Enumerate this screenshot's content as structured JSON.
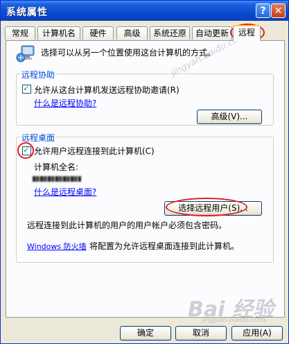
{
  "window": {
    "title": "系统属性"
  },
  "title_buttons": {
    "help": "?",
    "close": "✕"
  },
  "tabs": [
    {
      "label": "常规"
    },
    {
      "label": "计算机名"
    },
    {
      "label": "硬件"
    },
    {
      "label": "高级"
    },
    {
      "label": "系统还原"
    },
    {
      "label": "自动更新"
    },
    {
      "label": "远程",
      "active": true
    }
  ],
  "intro": {
    "text": "选择可以从另一个位置使用这台计算机的方式。"
  },
  "remote_assistance": {
    "group_title": "远程协助",
    "checkbox_label": "允许从这台计算机发送远程协助邀请(R)",
    "checked": true,
    "help_link": "什么是远程协助?",
    "advanced_button": "高级(V)..."
  },
  "remote_desktop": {
    "group_title": "远程桌面",
    "checkbox_label": "允许用户远程连接到此计算机(C)",
    "checked": true,
    "computer_name_label": "计算机全名:",
    "help_link": "什么是远程桌面?",
    "select_users_button": "选择远程用户(S)...",
    "note": "远程连接到此计算机的用户的用户帐户必须包含密码。",
    "firewall_link": "Windows 防火墙",
    "firewall_text": "将配置为允许远程桌面连接到此计算机。"
  },
  "footer": {
    "ok": "确定",
    "cancel": "取消",
    "apply": "应用(A)"
  },
  "watermarks": {
    "top_right": "jingyan.baidu.com",
    "logo": "Bai 经验",
    "bottom": "jingyan.baidu.com"
  },
  "colors": {
    "title_bar": "#0a4bd0",
    "group_title": "#0046d5",
    "link": "#0000ff",
    "annotation": "#e02020",
    "check": "#21a121"
  }
}
